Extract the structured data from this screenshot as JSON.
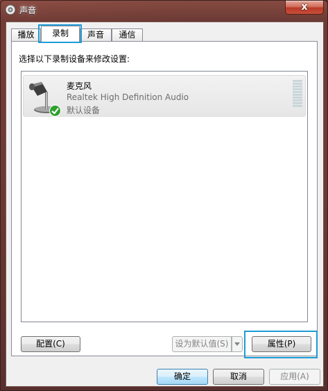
{
  "window": {
    "title": "声音",
    "close_label": "x"
  },
  "tabs": [
    {
      "label": "播放"
    },
    {
      "label": "录制",
      "active": true
    },
    {
      "label": "声音"
    },
    {
      "label": "通信"
    }
  ],
  "recording": {
    "instruction": "选择以下录制设备来修改设置:",
    "devices": [
      {
        "name": "麦克风",
        "description": "Realtek High Definition Audio",
        "status": "默认设备",
        "icon": "microphone-icon",
        "badge_icon": "checkmark-icon",
        "level": 0
      }
    ]
  },
  "panel_buttons": {
    "configure_label": "配置(C)",
    "set_default_label": "设为默认值(S)",
    "properties_label": "属性(P)"
  },
  "dialog_buttons": {
    "ok_label": "确定",
    "cancel_label": "取消",
    "apply_label": "应用(A)"
  },
  "colors": {
    "highlight": "#1e9bd7",
    "default_badge": "#2ea12e"
  }
}
